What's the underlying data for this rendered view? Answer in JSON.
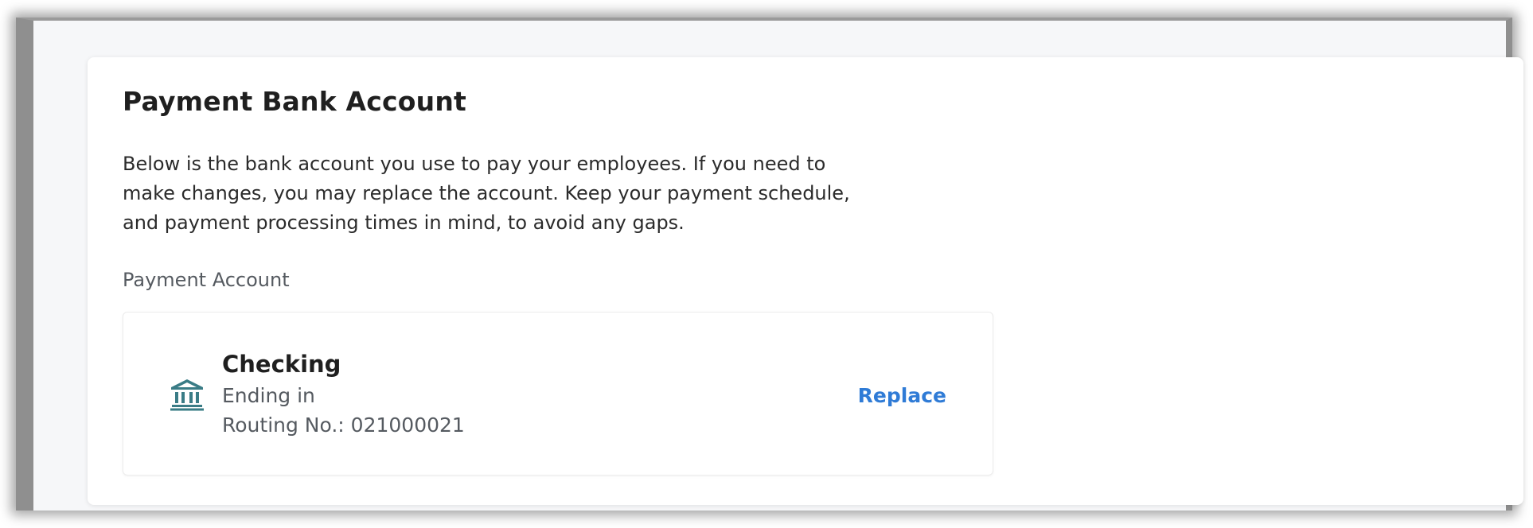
{
  "card": {
    "title": "Payment Bank Account",
    "description": "Below is the bank account you use to pay your employees. If you need to make changes, you may replace the account. Keep your payment schedule, and payment processing times in mind, to avoid any gaps.",
    "field_label": "Payment Account"
  },
  "account": {
    "icon": "bank-icon",
    "type": "Checking",
    "ending_text": "Ending in",
    "routing_text": "Routing No.: 021000021",
    "replace_label": "Replace"
  },
  "colors": {
    "accent": "#2f7bd6",
    "icon": "#3a7c86"
  }
}
